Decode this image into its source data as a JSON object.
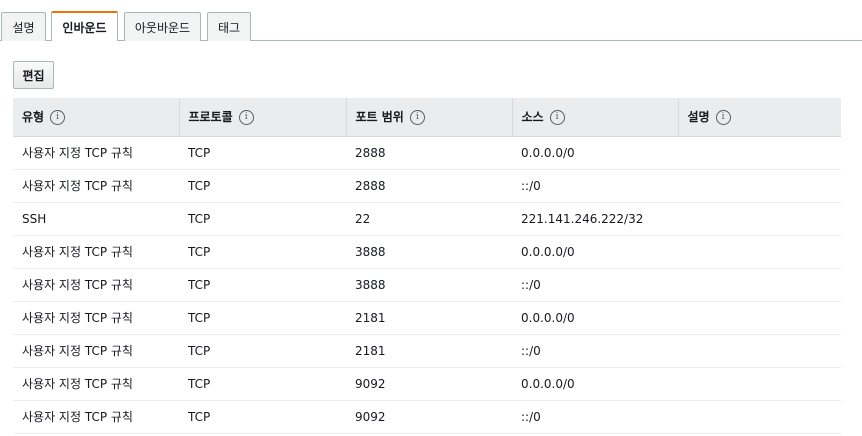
{
  "tabs": [
    {
      "label": "설명",
      "active": false
    },
    {
      "label": "인바운드",
      "active": true
    },
    {
      "label": "아웃바운드",
      "active": false
    },
    {
      "label": "태그",
      "active": false
    }
  ],
  "edit_button": "편집",
  "columns": [
    "유형",
    "프로토콜",
    "포트 범위",
    "소스",
    "설명"
  ],
  "info_icon_glyph": "i",
  "rows": [
    {
      "type": "사용자 지정 TCP 규칙",
      "protocol": "TCP",
      "port": "2888",
      "source": "0.0.0.0/0",
      "description": ""
    },
    {
      "type": "사용자 지정 TCP 규칙",
      "protocol": "TCP",
      "port": "2888",
      "source": "::/0",
      "description": ""
    },
    {
      "type": "SSH",
      "protocol": "TCP",
      "port": "22",
      "source": "221.141.246.222/32",
      "description": ""
    },
    {
      "type": "사용자 지정 TCP 규칙",
      "protocol": "TCP",
      "port": "3888",
      "source": "0.0.0.0/0",
      "description": ""
    },
    {
      "type": "사용자 지정 TCP 규칙",
      "protocol": "TCP",
      "port": "3888",
      "source": "::/0",
      "description": ""
    },
    {
      "type": "사용자 지정 TCP 규칙",
      "protocol": "TCP",
      "port": "2181",
      "source": "0.0.0.0/0",
      "description": ""
    },
    {
      "type": "사용자 지정 TCP 규칙",
      "protocol": "TCP",
      "port": "2181",
      "source": "::/0",
      "description": ""
    },
    {
      "type": "사용자 지정 TCP 규칙",
      "protocol": "TCP",
      "port": "9092",
      "source": "0.0.0.0/0",
      "description": ""
    },
    {
      "type": "사용자 지정 TCP 규칙",
      "protocol": "TCP",
      "port": "9092",
      "source": "::/0",
      "description": ""
    }
  ],
  "colors": {
    "active_tab_accent": "#ec7211",
    "header_bg": "#eaeded",
    "border": "#aab7b8"
  }
}
